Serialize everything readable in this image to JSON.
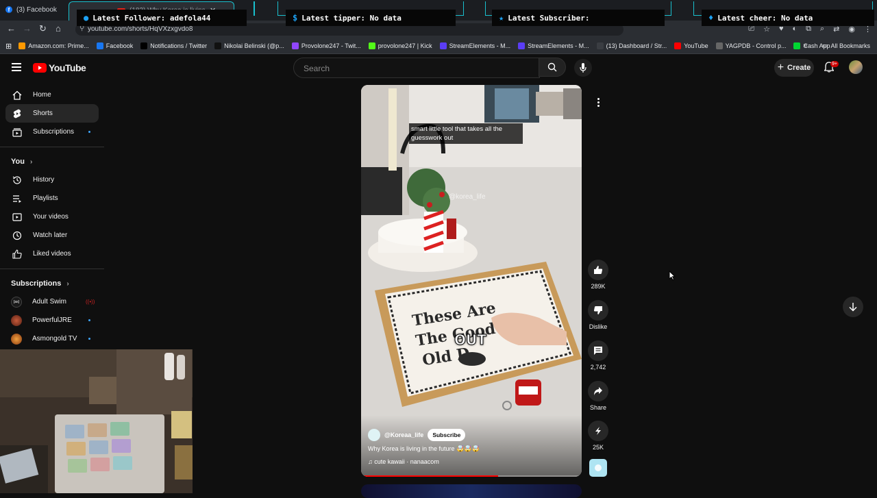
{
  "browser": {
    "tabs": [
      {
        "label": "(3) Facebook"
      },
      {
        "label": "(183) Why Korea is living in..."
      }
    ],
    "url": "youtube.com/shorts/HqVXzxgvdo8",
    "bookmarks": [
      {
        "label": "Amazon.com: Prime...",
        "icon": "amazon-icon",
        "color": "#ff9900"
      },
      {
        "label": "Facebook",
        "icon": "facebook-icon",
        "color": "#1877f2"
      },
      {
        "label": "Notifications / Twitter",
        "icon": "x-icon",
        "color": "#000000"
      },
      {
        "label": "Nikolai Belinski (@p...",
        "icon": "tiktok-icon",
        "color": "#111111"
      },
      {
        "label": "Provolone247 - Twit...",
        "icon": "twitch-icon",
        "color": "#9146ff"
      },
      {
        "label": "provolone247 | Kick",
        "icon": "kick-icon",
        "color": "#53fc18"
      },
      {
        "label": "StreamElements - M...",
        "icon": "streamelements-icon",
        "color": "#5b3df5"
      },
      {
        "label": "StreamElements - M...",
        "icon": "streamelements-icon",
        "color": "#5b3df5"
      },
      {
        "label": "(13) Dashboard / Str...",
        "icon": "dashboard-icon",
        "color": "#3a3d42"
      },
      {
        "label": "YouTube",
        "icon": "youtube-icon",
        "color": "#ff0000"
      },
      {
        "label": "YAGPDB - Control p...",
        "icon": "yagpdb-icon",
        "color": "#666666"
      },
      {
        "label": "Cash App",
        "icon": "cashapp-icon",
        "color": "#00d632"
      }
    ],
    "all_bookmarks_label": "All Bookmarks"
  },
  "stream_overlays": [
    {
      "label": "Latest Follower: adefola44",
      "icon": "user-icon"
    },
    {
      "label": "Latest tipper: No data",
      "icon": "dollar-icon"
    },
    {
      "label": "Latest Subscriber:",
      "icon": "star-icon"
    },
    {
      "label": "Latest cheer: No data",
      "icon": "diamond-icon"
    }
  ],
  "header": {
    "logo": "YouTube",
    "search_placeholder": "Search",
    "create_label": "Create",
    "notif_badge": "9+"
  },
  "sidebar": {
    "main": [
      {
        "label": "Home",
        "icon": "home-icon"
      },
      {
        "label": "Shorts",
        "icon": "shorts-icon"
      },
      {
        "label": "Subscriptions",
        "icon": "subscriptions-icon"
      }
    ],
    "you_heading": "You",
    "you_items": [
      {
        "label": "History",
        "icon": "history-icon"
      },
      {
        "label": "Playlists",
        "icon": "playlists-icon"
      },
      {
        "label": "Your videos",
        "icon": "your-videos-icon"
      },
      {
        "label": "Watch later",
        "icon": "watch-later-icon"
      },
      {
        "label": "Liked videos",
        "icon": "liked-icon"
      }
    ],
    "subs_heading": "Subscriptions",
    "channels": [
      {
        "label": "Adult Swim",
        "color": "#111111"
      },
      {
        "label": "PowerfulJRE",
        "color": "#7a3b2e"
      },
      {
        "label": "Asmongold TV",
        "color": "#c55a1a"
      }
    ]
  },
  "short": {
    "caption": "smart little tool that takes all the guesswork out",
    "watermark": "@korea_life",
    "overlay_word": "OUT",
    "channel": "@Koreaa_life",
    "subscribe_label": "Subscribe",
    "title": "Why Korea is living in the future 🤯🤯🤯",
    "music": "cute kawaii · nanaacom",
    "progress": 0.62,
    "actions": {
      "likes": "289K",
      "dislike_label": "Dislike",
      "comments": "2,742",
      "share_label": "Share",
      "remix": "25K"
    }
  }
}
